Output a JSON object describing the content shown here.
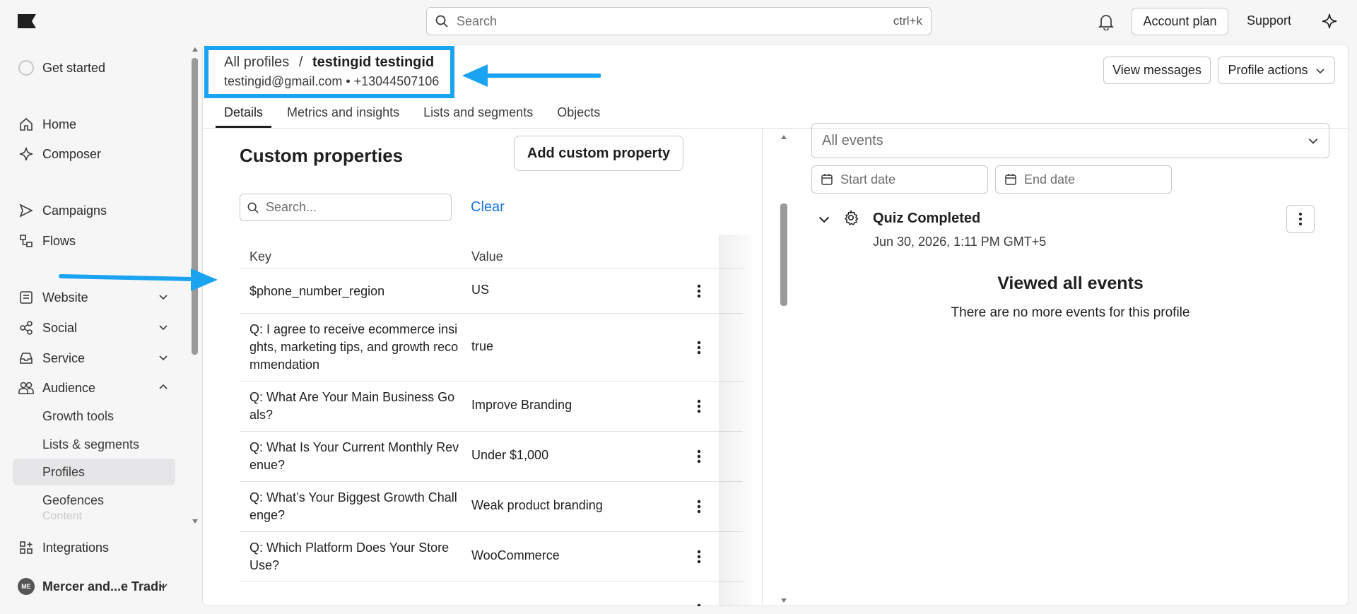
{
  "topbar": {
    "search_placeholder": "Search",
    "search_shortcut": "ctrl+k",
    "account_plan": "Account plan",
    "support": "Support"
  },
  "sidebar": {
    "get_started": "Get started",
    "items": {
      "home": "Home",
      "composer": "Composer",
      "campaigns": "Campaigns",
      "flows": "Flows",
      "website": "Website",
      "social": "Social",
      "service": "Service",
      "audience": "Audience"
    },
    "audience_sub": {
      "growth_tools": "Growth tools",
      "lists_segments": "Lists & segments",
      "profiles": "Profiles",
      "geofences": "Geofences",
      "content": "Content"
    },
    "integrations": "Integrations",
    "account_initials": "ME",
    "account_name": "Mercer and...e Trading"
  },
  "profile": {
    "breadcrumb_root": "All profiles",
    "breadcrumb_sep": "/",
    "name": "testingid testingid",
    "contact": "testingid@gmail.com • +13044507106",
    "view_messages": "View messages",
    "profile_actions": "Profile actions"
  },
  "tabs": [
    "Details",
    "Metrics and insights",
    "Lists and segments",
    "Objects"
  ],
  "custom_properties": {
    "title": "Custom properties",
    "add_button": "Add custom property",
    "search_placeholder": "Search...",
    "clear": "Clear",
    "col_key": "Key",
    "col_value": "Value",
    "rows": [
      {
        "key": "$phone_number_region",
        "value": "US"
      },
      {
        "key": "Q: I agree to receive ecommerce insights, marketing tips, and growth recommendation",
        "value": "true"
      },
      {
        "key": "Q: What Are Your Main Business Goals?",
        "value": "Improve Branding"
      },
      {
        "key": "Q: What Is Your Current Monthly Revenue?",
        "value": "Under $1,000"
      },
      {
        "key": "Q: What’s Your Biggest Growth Challenge?",
        "value": "Weak product branding"
      },
      {
        "key": "Q: Which Platform Does Your Store Use?",
        "value": "WooCommerce"
      }
    ]
  },
  "events": {
    "filter_placeholder": "All events",
    "start_date": "Start date",
    "end_date": "End date",
    "event_title": "Quiz Completed",
    "event_time": "Jun 30, 2026, 1:11 PM GMT+5",
    "viewed_title": "Viewed all events",
    "viewed_sub": "There are no more events for this profile"
  },
  "colors": {
    "annotation_blue": "#1aa3f0",
    "link_blue": "#1a73d9"
  }
}
